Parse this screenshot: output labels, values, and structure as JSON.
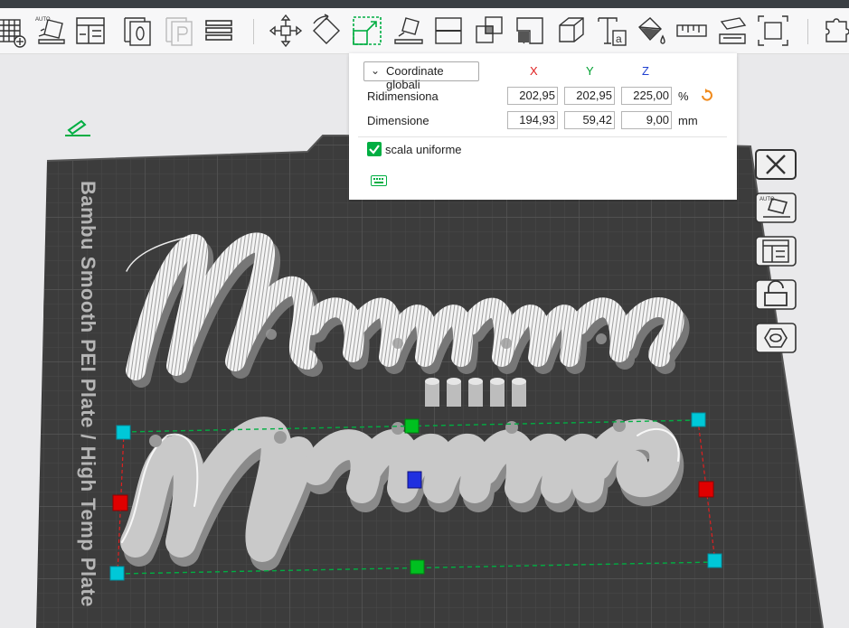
{
  "toolbar": {
    "tools": [
      {
        "name": "grid-add-icon"
      },
      {
        "name": "auto-orient-icon"
      },
      {
        "name": "arrange-icon"
      },
      {
        "name": "plate-o-icon"
      },
      {
        "name": "plate-p-icon"
      },
      {
        "name": "layers-icon"
      },
      {
        "name": "move-icon"
      },
      {
        "name": "rotate-icon"
      },
      {
        "name": "scale-icon"
      },
      {
        "name": "lay-on-face-icon"
      },
      {
        "name": "cut-icon"
      },
      {
        "name": "boolean-icon"
      },
      {
        "name": "support-paint-icon"
      },
      {
        "name": "cube-icon"
      },
      {
        "name": "text-icon"
      },
      {
        "name": "color-paint-icon"
      },
      {
        "name": "measure-icon"
      },
      {
        "name": "assembly-icon"
      },
      {
        "name": "fit-view-icon"
      },
      {
        "name": "puzzle-icon"
      }
    ],
    "auto_label": "AUTO"
  },
  "popup": {
    "coord_system": "Coordinate globali",
    "axes": {
      "x": "X",
      "y": "Y",
      "z": "Z"
    },
    "scale": {
      "label": "Ridimensiona",
      "x": "202,95",
      "y": "202,95",
      "z": "225,00",
      "unit": "%"
    },
    "size": {
      "label": "Dimensione",
      "x": "194,93",
      "y": "59,42",
      "z": "9,00",
      "unit": "mm"
    },
    "uniform_scale": {
      "label": "scala uniforme",
      "checked": true
    }
  },
  "plate": {
    "label": "Bambu Smooth PEI Plate / High Temp Plate",
    "objects": [
      {
        "text": "Mamma",
        "style": "script-white-hatched",
        "selected": false
      },
      {
        "text": "Mamma",
        "style": "script-grey",
        "selected": true
      }
    ]
  },
  "side_toolbar": [
    {
      "name": "close-icon"
    },
    {
      "name": "auto-orient-icon"
    },
    {
      "name": "arrange-icon"
    },
    {
      "name": "lock-icon"
    },
    {
      "name": "hexagon-icon"
    }
  ],
  "colors": {
    "accent": "#00ae42",
    "axis_x": "#e02020",
    "axis_y": "#00a030",
    "axis_z": "#2040d0",
    "plate": "#3c3c3c",
    "handle_corner": "#00c8d8",
    "reset_arrow": "#f08a1c"
  }
}
